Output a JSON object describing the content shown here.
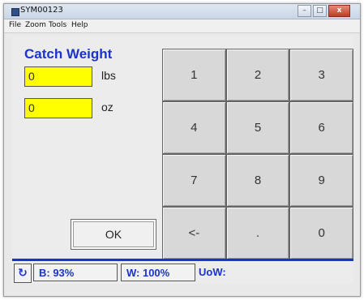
{
  "window": {
    "title": "SYM00123",
    "buttons": {
      "minimize": "–",
      "maximize": "□",
      "close": "x"
    }
  },
  "menu": [
    "File",
    "Zoom",
    "Tools",
    "Help"
  ],
  "catch_weight": {
    "title": "Catch Weight",
    "lbs_value": "0",
    "lbs_unit": "lbs",
    "oz_value": "0",
    "oz_unit": "oz"
  },
  "ok_button": "OK",
  "keypad": [
    "1",
    "2",
    "3",
    "4",
    "5",
    "6",
    "7",
    "8",
    "9",
    "<-",
    ".",
    "0"
  ],
  "status": {
    "refresh_glyph": "↻",
    "battery": "B: 93%",
    "wifi": "W: 100%",
    "uow": "UoW:"
  },
  "colors": {
    "accent_blue": "#1a33cc",
    "field_yellow": "#ffff00"
  }
}
